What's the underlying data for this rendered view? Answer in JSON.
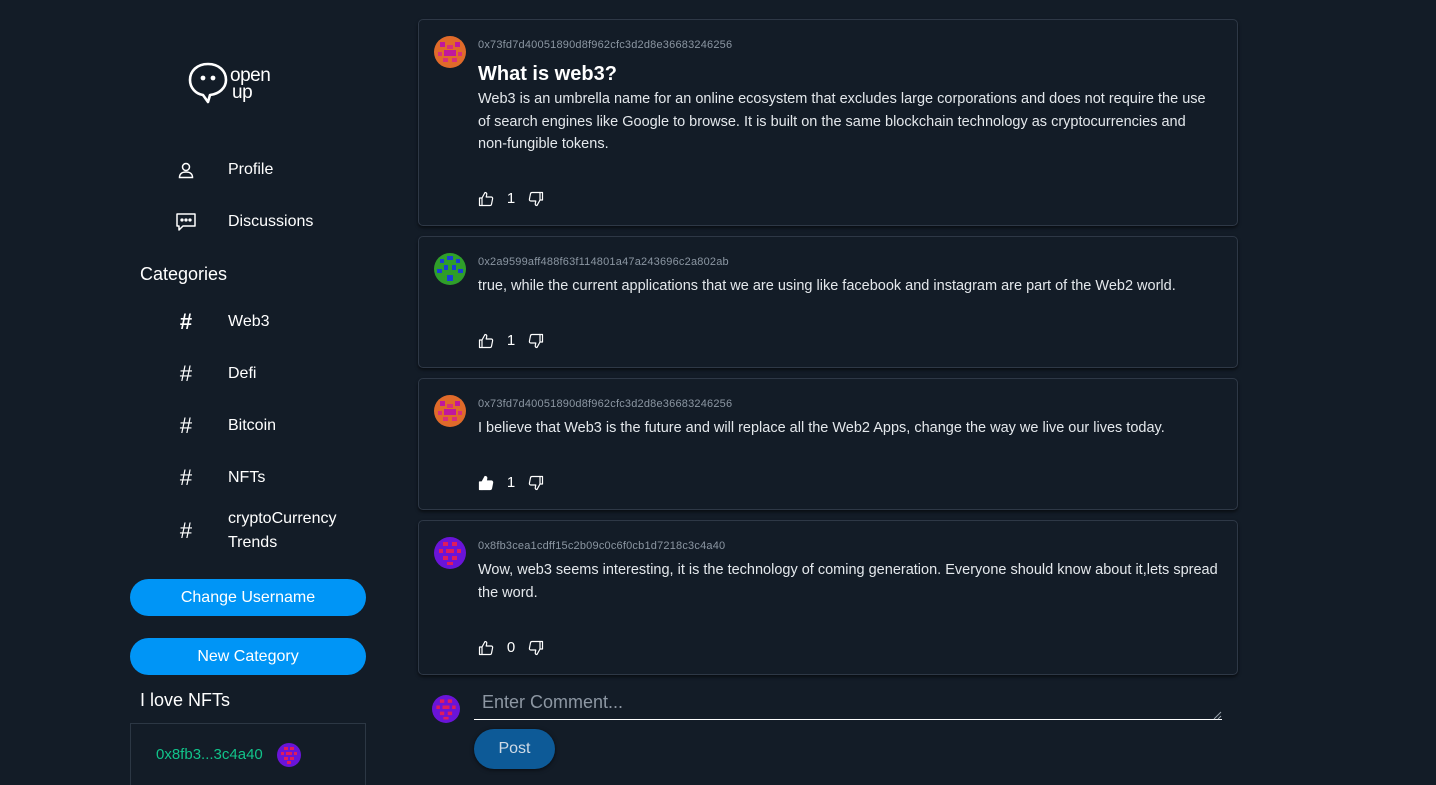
{
  "app": {
    "logo_text_line1": "open",
    "logo_text_line2": "up"
  },
  "sidebar": {
    "nav": [
      {
        "label": "Profile",
        "icon": "user-icon"
      },
      {
        "label": "Discussions",
        "icon": "chat-icon"
      }
    ],
    "categories_title": "Categories",
    "categories": [
      {
        "label": "Web3",
        "icon": "hash-icon",
        "active": true
      },
      {
        "label": "Defi",
        "icon": "hash-icon"
      },
      {
        "label": "Bitcoin",
        "icon": "hash-icon"
      },
      {
        "label": "NFTs",
        "icon": "hash-icon"
      },
      {
        "label": "cryptoCurrency Trends",
        "icon": "hash-icon"
      }
    ],
    "change_username_label": "Change Username",
    "new_category_label": "New Category",
    "status_text": "I love NFTs",
    "user_short_address": "0x8fb3...3c4a40"
  },
  "feed": {
    "posts": [
      {
        "address": "0x73fd7d40051890d8f962cfc3d2d8e36683246256",
        "title": "What is web3?",
        "body": "Web3 is an umbrella name for an online ecosystem that excludes large corporations and does not require the use of search engines like Google to browse. It is built on the same blockchain technology as cryptocurrencies and non-fungible tokens.",
        "likes": "1",
        "liked": false
      },
      {
        "address": "0x2a9599aff488f63f114801a47a243696c2a802ab",
        "body": "true, while the current applications that we are using like facebook and instagram are part of the Web2 world.",
        "likes": "1",
        "liked": false
      },
      {
        "address": "0x73fd7d40051890d8f962cfc3d2d8e36683246256",
        "body": "I believe that Web3 is the future and will replace all the Web2 Apps, change the way we live our lives today.",
        "likes": "1",
        "liked": true
      },
      {
        "address": "0x8fb3cea1cdff15c2b09c0c6f0cb1d7218c3c4a40",
        "body": "Wow, web3 seems interesting, it is the technology of coming generation. Everyone should know about it,lets spread the word.",
        "likes": "0",
        "liked": false
      }
    ],
    "comment_placeholder": "Enter Comment...",
    "post_button_label": "Post"
  },
  "colors": {
    "background": "#131c27",
    "accent": "#0095f6",
    "address_green": "#11c38a",
    "post_button": "#0d5a97"
  }
}
